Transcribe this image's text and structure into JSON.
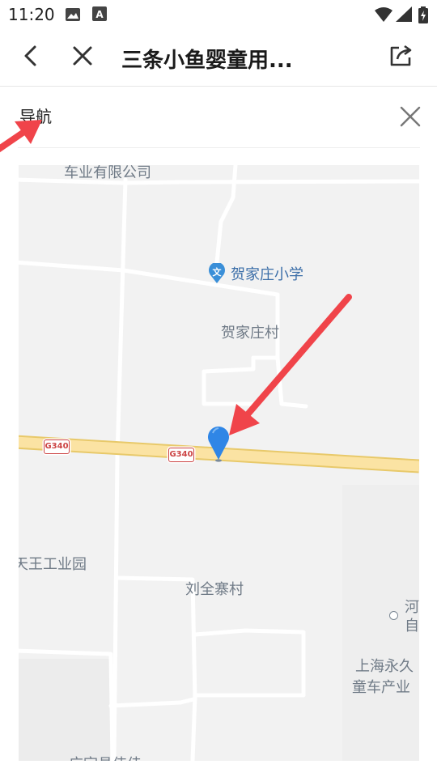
{
  "status_bar": {
    "time": "11:20",
    "icons": [
      "image-icon",
      "text-a-icon",
      "wifi-icon",
      "signal-icon",
      "battery-icon"
    ]
  },
  "nav": {
    "title": "三条小鱼婴童用...",
    "icons": [
      "back-icon",
      "close-icon",
      "share-icon"
    ]
  },
  "panel": {
    "title": "导航"
  },
  "map": {
    "poi": {
      "school": "贺家庄小学"
    },
    "labels": {
      "top_company": "车业有限公司",
      "village1": "贺家庄村",
      "industrial_park": "天王工业园",
      "village2": "刘全寨村",
      "right_top1": "河",
      "right_top2": "自",
      "right_company1": "上海永久",
      "right_company2": "童车产业",
      "bottom": "广宗县伟佳"
    },
    "road_shield": "G340"
  },
  "colors": {
    "pin": "#2f86e6",
    "arrow": "#f0444a",
    "road_main": "#fbe3a3",
    "map_bg": "#f2f2f2"
  }
}
